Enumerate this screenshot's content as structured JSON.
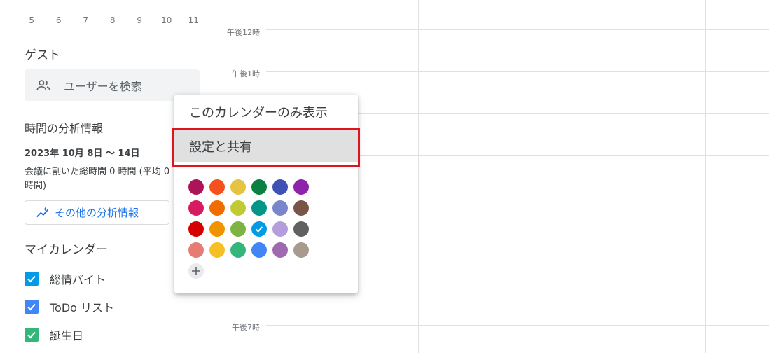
{
  "mini_calendar": {
    "days": [
      "5",
      "6",
      "7",
      "8",
      "9",
      "10",
      "11"
    ]
  },
  "guests": {
    "title": "ゲスト",
    "search_placeholder": "ユーザーを検索",
    "icon": "people-icon"
  },
  "time_insights": {
    "title": "時間の分析情報",
    "range": "2023年 10月 8日 ～ 14日",
    "summary": "会議に割いた総時間 0 時間 (平均 0 時間)",
    "more_button": "その他の分析情報",
    "more_icon": "insights-icon"
  },
  "my_calendars": {
    "title": "マイカレンダー",
    "items": [
      {
        "label": "総情バイト",
        "color": "#039be5"
      },
      {
        "label": "ToDo リスト",
        "color": "#4285f4"
      },
      {
        "label": "誕生日",
        "color": "#33b679"
      }
    ]
  },
  "time_grid": {
    "labels": [
      "午後12時",
      "午後1時",
      "午後7時"
    ],
    "line_color": "#e0e0e0"
  },
  "context_menu": {
    "items": [
      "このカレンダーのみ表示",
      "設定と共有"
    ],
    "selected_index": 1,
    "highlight_color": "#e0141e",
    "colors": [
      [
        "#ad1457",
        "#f4511e",
        "#e4c441",
        "#0b8043",
        "#3f51b5",
        "#8e24aa"
      ],
      [
        "#d81b60",
        "#ef6c00",
        "#c0ca33",
        "#009688",
        "#7986cb",
        "#795548"
      ],
      [
        "#d50000",
        "#f09300",
        "#7cb342",
        "#039be5",
        "#b39ddb",
        "#616161"
      ],
      [
        "#e67c73",
        "#f6bf26",
        "#33b679",
        "#4285f4",
        "#9e69af",
        "#a79b8e"
      ]
    ],
    "selected_color": "#039be5",
    "add_icon": "plus-icon"
  }
}
